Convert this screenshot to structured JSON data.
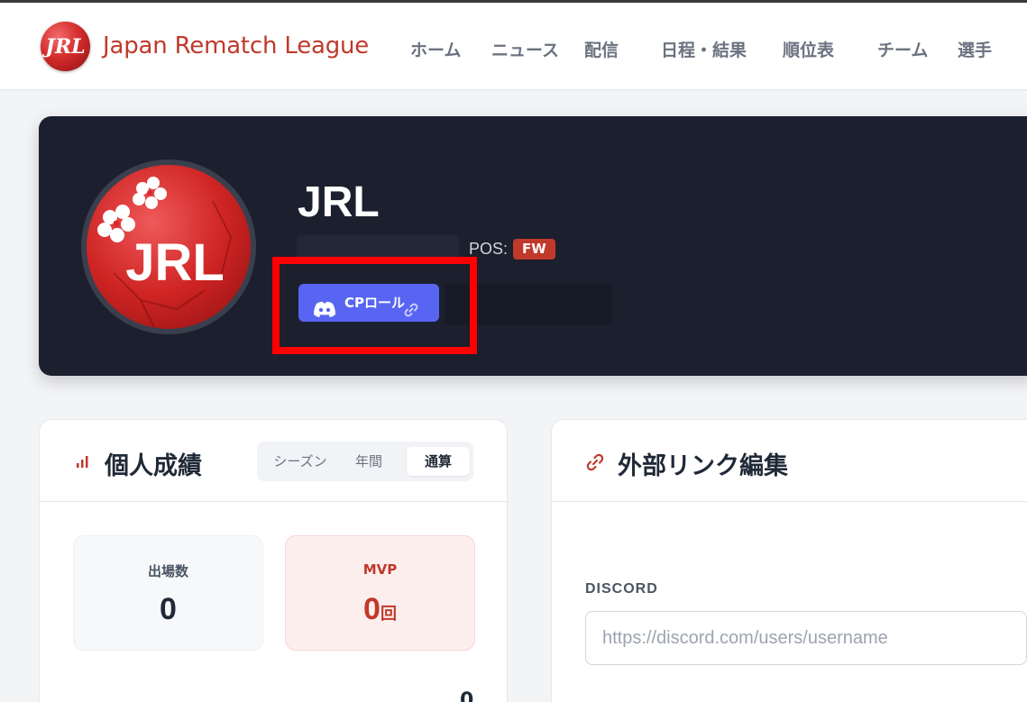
{
  "header": {
    "brand": "Japan Rematch League",
    "nav": [
      "ホーム",
      "ニュース",
      "配信",
      "日程・結果",
      "順位表",
      "チーム",
      "選手"
    ]
  },
  "player": {
    "name": "JRL",
    "avatar_text": "JRL",
    "pos_label": "POS:",
    "position": "FW",
    "discord_button": "CPロール"
  },
  "stats_card": {
    "title": "個人成績",
    "tabs": [
      "シーズン",
      "年間",
      "通算"
    ],
    "active_tab": "通算",
    "stats": [
      {
        "label": "出場数",
        "value": "0",
        "unit": ""
      },
      {
        "label": "MVP",
        "value": "0",
        "unit": "回"
      }
    ],
    "partial_value": "0"
  },
  "links_card": {
    "title": "外部リンク編集",
    "field_label": "DISCORD",
    "field_value": "",
    "field_placeholder": "https://discord.com/users/username"
  },
  "colors": {
    "brand_red": "#c0392b",
    "hero_bg": "#1c1f2e",
    "discord_blurple": "#5865f2",
    "highlight": "#ff0000"
  },
  "icons": [
    "logo-icon",
    "bar-chart-icon",
    "link-icon",
    "discord-icon"
  ]
}
